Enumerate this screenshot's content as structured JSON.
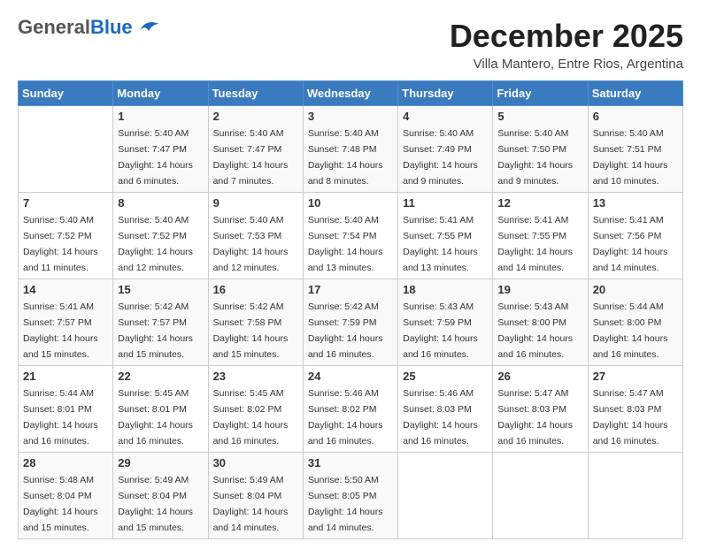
{
  "header": {
    "logo_general": "General",
    "logo_blue": "Blue",
    "month_title": "December 2025",
    "location": "Villa Mantero, Entre Rios, Argentina"
  },
  "weekdays": [
    "Sunday",
    "Monday",
    "Tuesday",
    "Wednesday",
    "Thursday",
    "Friday",
    "Saturday"
  ],
  "weeks": [
    [
      {
        "day": "",
        "sunrise": "",
        "sunset": "",
        "daylight": ""
      },
      {
        "day": "1",
        "sunrise": "Sunrise: 5:40 AM",
        "sunset": "Sunset: 7:47 PM",
        "daylight": "Daylight: 14 hours and 6 minutes."
      },
      {
        "day": "2",
        "sunrise": "Sunrise: 5:40 AM",
        "sunset": "Sunset: 7:47 PM",
        "daylight": "Daylight: 14 hours and 7 minutes."
      },
      {
        "day": "3",
        "sunrise": "Sunrise: 5:40 AM",
        "sunset": "Sunset: 7:48 PM",
        "daylight": "Daylight: 14 hours and 8 minutes."
      },
      {
        "day": "4",
        "sunrise": "Sunrise: 5:40 AM",
        "sunset": "Sunset: 7:49 PM",
        "daylight": "Daylight: 14 hours and 9 minutes."
      },
      {
        "day": "5",
        "sunrise": "Sunrise: 5:40 AM",
        "sunset": "Sunset: 7:50 PM",
        "daylight": "Daylight: 14 hours and 9 minutes."
      },
      {
        "day": "6",
        "sunrise": "Sunrise: 5:40 AM",
        "sunset": "Sunset: 7:51 PM",
        "daylight": "Daylight: 14 hours and 10 minutes."
      }
    ],
    [
      {
        "day": "7",
        "sunrise": "Sunrise: 5:40 AM",
        "sunset": "Sunset: 7:52 PM",
        "daylight": "Daylight: 14 hours and 11 minutes."
      },
      {
        "day": "8",
        "sunrise": "Sunrise: 5:40 AM",
        "sunset": "Sunset: 7:52 PM",
        "daylight": "Daylight: 14 hours and 12 minutes."
      },
      {
        "day": "9",
        "sunrise": "Sunrise: 5:40 AM",
        "sunset": "Sunset: 7:53 PM",
        "daylight": "Daylight: 14 hours and 12 minutes."
      },
      {
        "day": "10",
        "sunrise": "Sunrise: 5:40 AM",
        "sunset": "Sunset: 7:54 PM",
        "daylight": "Daylight: 14 hours and 13 minutes."
      },
      {
        "day": "11",
        "sunrise": "Sunrise: 5:41 AM",
        "sunset": "Sunset: 7:55 PM",
        "daylight": "Daylight: 14 hours and 13 minutes."
      },
      {
        "day": "12",
        "sunrise": "Sunrise: 5:41 AM",
        "sunset": "Sunset: 7:55 PM",
        "daylight": "Daylight: 14 hours and 14 minutes."
      },
      {
        "day": "13",
        "sunrise": "Sunrise: 5:41 AM",
        "sunset": "Sunset: 7:56 PM",
        "daylight": "Daylight: 14 hours and 14 minutes."
      }
    ],
    [
      {
        "day": "14",
        "sunrise": "Sunrise: 5:41 AM",
        "sunset": "Sunset: 7:57 PM",
        "daylight": "Daylight: 14 hours and 15 minutes."
      },
      {
        "day": "15",
        "sunrise": "Sunrise: 5:42 AM",
        "sunset": "Sunset: 7:57 PM",
        "daylight": "Daylight: 14 hours and 15 minutes."
      },
      {
        "day": "16",
        "sunrise": "Sunrise: 5:42 AM",
        "sunset": "Sunset: 7:58 PM",
        "daylight": "Daylight: 14 hours and 15 minutes."
      },
      {
        "day": "17",
        "sunrise": "Sunrise: 5:42 AM",
        "sunset": "Sunset: 7:59 PM",
        "daylight": "Daylight: 14 hours and 16 minutes."
      },
      {
        "day": "18",
        "sunrise": "Sunrise: 5:43 AM",
        "sunset": "Sunset: 7:59 PM",
        "daylight": "Daylight: 14 hours and 16 minutes."
      },
      {
        "day": "19",
        "sunrise": "Sunrise: 5:43 AM",
        "sunset": "Sunset: 8:00 PM",
        "daylight": "Daylight: 14 hours and 16 minutes."
      },
      {
        "day": "20",
        "sunrise": "Sunrise: 5:44 AM",
        "sunset": "Sunset: 8:00 PM",
        "daylight": "Daylight: 14 hours and 16 minutes."
      }
    ],
    [
      {
        "day": "21",
        "sunrise": "Sunrise: 5:44 AM",
        "sunset": "Sunset: 8:01 PM",
        "daylight": "Daylight: 14 hours and 16 minutes."
      },
      {
        "day": "22",
        "sunrise": "Sunrise: 5:45 AM",
        "sunset": "Sunset: 8:01 PM",
        "daylight": "Daylight: 14 hours and 16 minutes."
      },
      {
        "day": "23",
        "sunrise": "Sunrise: 5:45 AM",
        "sunset": "Sunset: 8:02 PM",
        "daylight": "Daylight: 14 hours and 16 minutes."
      },
      {
        "day": "24",
        "sunrise": "Sunrise: 5:46 AM",
        "sunset": "Sunset: 8:02 PM",
        "daylight": "Daylight: 14 hours and 16 minutes."
      },
      {
        "day": "25",
        "sunrise": "Sunrise: 5:46 AM",
        "sunset": "Sunset: 8:03 PM",
        "daylight": "Daylight: 14 hours and 16 minutes."
      },
      {
        "day": "26",
        "sunrise": "Sunrise: 5:47 AM",
        "sunset": "Sunset: 8:03 PM",
        "daylight": "Daylight: 14 hours and 16 minutes."
      },
      {
        "day": "27",
        "sunrise": "Sunrise: 5:47 AM",
        "sunset": "Sunset: 8:03 PM",
        "daylight": "Daylight: 14 hours and 16 minutes."
      }
    ],
    [
      {
        "day": "28",
        "sunrise": "Sunrise: 5:48 AM",
        "sunset": "Sunset: 8:04 PM",
        "daylight": "Daylight: 14 hours and 15 minutes."
      },
      {
        "day": "29",
        "sunrise": "Sunrise: 5:49 AM",
        "sunset": "Sunset: 8:04 PM",
        "daylight": "Daylight: 14 hours and 15 minutes."
      },
      {
        "day": "30",
        "sunrise": "Sunrise: 5:49 AM",
        "sunset": "Sunset: 8:04 PM",
        "daylight": "Daylight: 14 hours and 14 minutes."
      },
      {
        "day": "31",
        "sunrise": "Sunrise: 5:50 AM",
        "sunset": "Sunset: 8:05 PM",
        "daylight": "Daylight: 14 hours and 14 minutes."
      },
      {
        "day": "",
        "sunrise": "",
        "sunset": "",
        "daylight": ""
      },
      {
        "day": "",
        "sunrise": "",
        "sunset": "",
        "daylight": ""
      },
      {
        "day": "",
        "sunrise": "",
        "sunset": "",
        "daylight": ""
      }
    ]
  ]
}
